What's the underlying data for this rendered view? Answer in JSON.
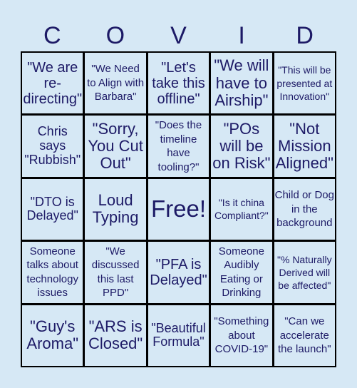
{
  "header": {
    "letters": [
      "C",
      "O",
      "V",
      "I",
      "D"
    ]
  },
  "board": {
    "rows": [
      [
        {
          "text": "\"We are re-directing\"",
          "size": "fs-ml"
        },
        {
          "text": "\"We Need to Align with Barbara\"",
          "size": "fs-s"
        },
        {
          "text": "\"Let's take this offline\"",
          "size": "fs-ml"
        },
        {
          "text": "\"We will have to Airship\"",
          "size": "fs-l"
        },
        {
          "text": "\"This will be presented at Innovation\"",
          "size": "fs-xs"
        }
      ],
      [
        {
          "text": "Chris says \"Rubbish\"",
          "size": "fs-m"
        },
        {
          "text": "\"Sorry, You Cut Out\"",
          "size": "fs-l"
        },
        {
          "text": "\"Does the timeline have tooling?\"",
          "size": "fs-s"
        },
        {
          "text": "\"POs will be on Risk\"",
          "size": "fs-l"
        },
        {
          "text": "\"Not Mission Aligned\"",
          "size": "fs-l"
        }
      ],
      [
        {
          "text": "\"DTO is Delayed\"",
          "size": "fs-m"
        },
        {
          "text": "Loud Typing",
          "size": "fs-l"
        },
        {
          "text": "Free!",
          "size": "fs-xl"
        },
        {
          "text": "\"Is it china Compliant?\"",
          "size": "fs-xs"
        },
        {
          "text": "Child or Dog in the background",
          "size": "fs-s"
        }
      ],
      [
        {
          "text": "Someone talks about technology issues",
          "size": "fs-s"
        },
        {
          "text": "\"We discussed this last PPD\"",
          "size": "fs-s"
        },
        {
          "text": "\"PFA is Delayed\"",
          "size": "fs-ml"
        },
        {
          "text": "Someone Audibly Eating or Drinking",
          "size": "fs-s"
        },
        {
          "text": "\"% Naturally Derived will be affected\"",
          "size": "fs-xs"
        }
      ],
      [
        {
          "text": "\"Guy's Aroma\"",
          "size": "fs-l"
        },
        {
          "text": "\"ARS is Closed\"",
          "size": "fs-l"
        },
        {
          "text": "\"Beautiful Formula\"",
          "size": "fs-m"
        },
        {
          "text": "\"Something about COVID-19\"",
          "size": "fs-s"
        },
        {
          "text": "\"Can we accelerate the launch\"",
          "size": "fs-s"
        }
      ]
    ]
  }
}
